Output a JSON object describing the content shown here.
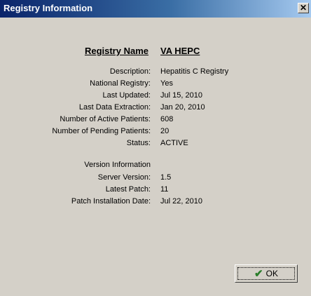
{
  "window": {
    "title": "Registry Information",
    "close_glyph": "✕"
  },
  "header": {
    "label": "Registry Name",
    "value": "VA HEPC"
  },
  "details": [
    {
      "label": "Description:",
      "value": "Hepatitis C Registry"
    },
    {
      "label": "National Registry:",
      "value": "Yes"
    },
    {
      "label": "Last Updated:",
      "value": "Jul 15, 2010"
    },
    {
      "label": "Last Data Extraction:",
      "value": "Jan 20, 2010"
    },
    {
      "label": "Number of Active Patients:",
      "value": "608"
    },
    {
      "label": "Number of Pending Patients:",
      "value": "20"
    },
    {
      "label": "Status:",
      "value": "ACTIVE"
    }
  ],
  "version": {
    "heading": "Version Information",
    "items": [
      {
        "label": "Server Version:",
        "value": "1.5"
      },
      {
        "label": "Latest Patch:",
        "value": "11"
      },
      {
        "label": "Patch Installation Date:",
        "value": "Jul 22, 2010"
      }
    ]
  },
  "ok_button": {
    "label": "OK",
    "icon": "checkmark-icon",
    "icon_color": "#2a7d2a"
  }
}
